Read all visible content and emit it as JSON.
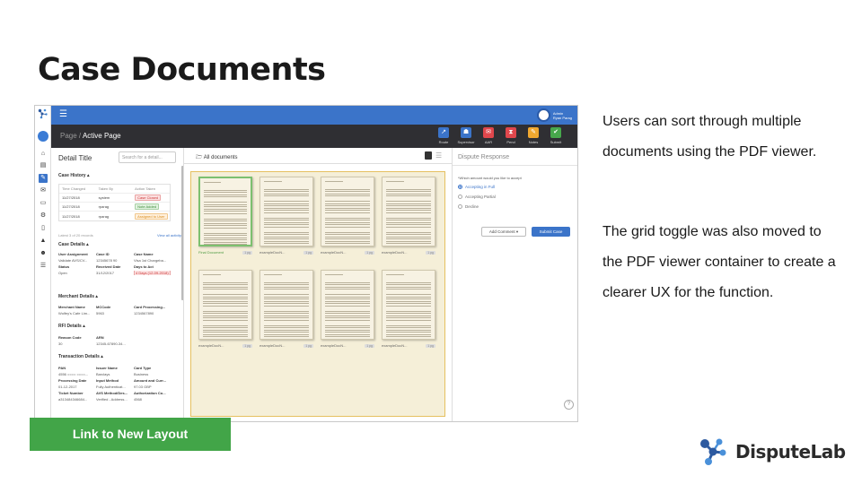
{
  "slide": {
    "title": "Case Documents",
    "description_1": "Users can sort through multiple documents using the PDF viewer.",
    "description_2": "The grid toggle was also moved to the PDF viewer container to create a clearer UX for the function.",
    "cta_label": "Link to New Layout",
    "brand_name": "DisputeLab"
  },
  "app": {
    "user": {
      "role": "Admin",
      "name": "Ryan Parag"
    },
    "breadcrumb": {
      "parent": "Page",
      "separator": "/",
      "current": "Active Page"
    },
    "actions": [
      {
        "label": "Route",
        "color": "#3b74c9",
        "icon": "↗"
      },
      {
        "label": "Supervisor",
        "color": "#3b74c9",
        "icon": "☗"
      },
      {
        "label": "AAR",
        "color": "#e0474c",
        "icon": "✉"
      },
      {
        "label": "Pend",
        "color": "#e0474c",
        "icon": "⧗"
      },
      {
        "label": "Notes",
        "color": "#f0a830",
        "icon": "✎"
      },
      {
        "label": "Submit",
        "color": "#47a84c",
        "icon": "✔"
      }
    ],
    "detail": {
      "title": "Detail Title",
      "search_placeholder": "Search for a detail...",
      "case_history": {
        "heading": "Case History",
        "columns": [
          "Time Changed",
          "Taken By",
          "Action Taken"
        ],
        "rows": [
          {
            "time": "11/27/2018",
            "by": "system",
            "action": "Case Closed",
            "badge": "red"
          },
          {
            "time": "11/27/2018",
            "by": "rparag",
            "action": "Note Added",
            "badge": "green"
          },
          {
            "time": "11/27/2018",
            "by": "rparag",
            "action": "Assigned to User",
            "badge": "orange"
          }
        ],
        "note": "Latest 3 of 20 records",
        "link": "View all activity"
      },
      "case_details": {
        "heading": "Case Details",
        "fields": [
          {
            "k": "User Assignment",
            "v": "Validate AVS/CV..."
          },
          {
            "k": "Case ID",
            "v": "12345678 90"
          },
          {
            "k": "Case Name",
            "v": "Visa 1st Chargeba..."
          },
          {
            "k": "Status",
            "v": "Open"
          },
          {
            "k": "Received Date",
            "v": "31/12/2017"
          },
          {
            "k": "Days to Act",
            "v": "4 Days (12-09-2018)"
          }
        ]
      },
      "merchant_details": {
        "heading": "Merchant Details",
        "fields": [
          {
            "k": "Merchant Name",
            "v": "Wolfey's Cafe Lim..."
          },
          {
            "k": "MCCode",
            "v": "5963"
          },
          {
            "k": "Card Processing...",
            "v": "1234567890"
          }
        ]
      },
      "rfi_details": {
        "heading": "RFI Details",
        "fields": [
          {
            "k": "Reason Code",
            "v": "30"
          },
          {
            "k": "ARN",
            "v": "12345-67890-34..."
          }
        ]
      },
      "transaction_details": {
        "heading": "Transaction Details",
        "fields": [
          {
            "k": "PAN",
            "v": "4556 ==== ====..."
          },
          {
            "k": "Issuer Name",
            "v": "Barclays"
          },
          {
            "k": "Card Type",
            "v": "Business"
          },
          {
            "k": "Processing Date",
            "v": "01-12-2017"
          },
          {
            "k": "Input Method",
            "v": "Fully Authenticat..."
          },
          {
            "k": "Amount and Curr...",
            "v": "97.03 GBP"
          },
          {
            "k": "Ticket Number",
            "v": "a313484346684..."
          },
          {
            "k": "AVS Method/Des...",
            "v": "Verified - Address..."
          },
          {
            "k": "Authorization Co...",
            "v": "4568"
          }
        ]
      }
    },
    "viewer": {
      "label": "All documents",
      "documents": [
        {
          "name": "Final Document",
          "tag": "1 pg",
          "selected": true
        },
        {
          "name": "exampleDocN...",
          "tag": "1 pg",
          "selected": false
        },
        {
          "name": "exampleDocN...",
          "tag": "1 pg",
          "selected": false
        },
        {
          "name": "exampleDocN...",
          "tag": "1 pg",
          "selected": false
        },
        {
          "name": "exampleDocN...",
          "tag": "1 pg",
          "selected": false
        },
        {
          "name": "exampleDocN...",
          "tag": "1 pg",
          "selected": false
        },
        {
          "name": "exampleDocN...",
          "tag": "1 pg",
          "selected": false
        },
        {
          "name": "exampleDocN...",
          "tag": "1 pg",
          "selected": false
        }
      ]
    },
    "dispute": {
      "title": "Dispute Response",
      "question": "*Which amount would you like to accept",
      "options": [
        {
          "label": "Accepting in Full",
          "selected": true
        },
        {
          "label": "Accepting Partial",
          "selected": false
        },
        {
          "label": "Decline",
          "selected": false
        }
      ],
      "add_comment": "Add Comment",
      "submit": "Submit Case",
      "help": "?"
    }
  }
}
